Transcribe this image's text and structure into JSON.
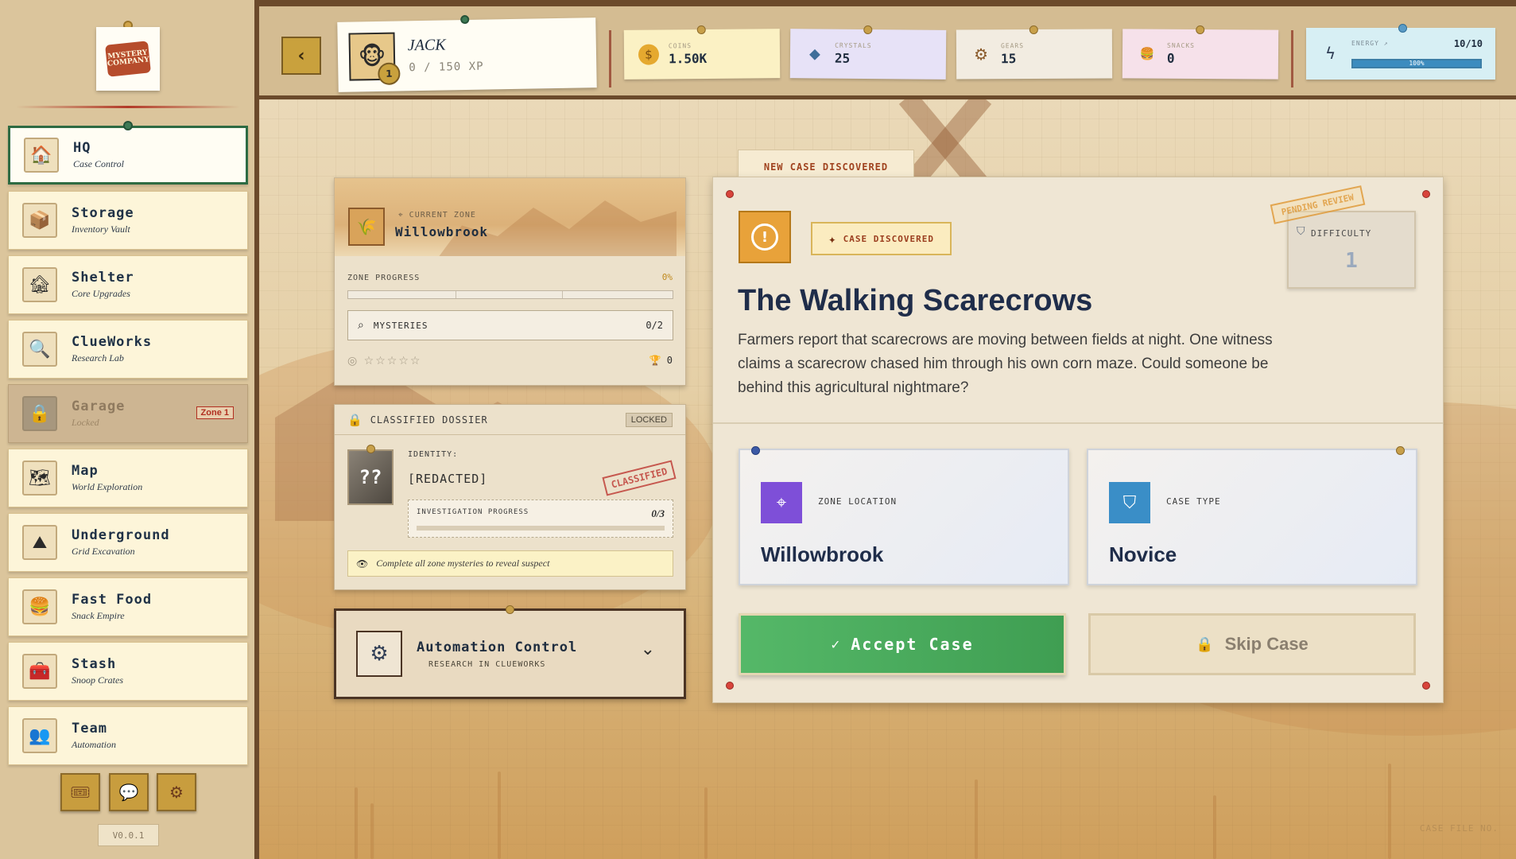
{
  "sidebar": {
    "logo_text": "MYSTERY COMPANY",
    "items": [
      {
        "title": "HQ",
        "subtitle": "Case Control",
        "icon": "🏠"
      },
      {
        "title": "Storage",
        "subtitle": "Inventory Vault",
        "icon": "📦"
      },
      {
        "title": "Shelter",
        "subtitle": "Core Upgrades",
        "icon": "🏚"
      },
      {
        "title": "ClueWorks",
        "subtitle": "Research Lab",
        "icon": "🔍"
      },
      {
        "title": "Garage",
        "subtitle": "Locked",
        "icon": "🔒",
        "tag": "Zone 1"
      },
      {
        "title": "Map",
        "subtitle": "World Exploration",
        "icon": "🗺"
      },
      {
        "title": "Underground",
        "subtitle": "Grid Excavation",
        "icon": "⛰"
      },
      {
        "title": "Fast Food",
        "subtitle": "Snack Empire",
        "icon": "🍔"
      },
      {
        "title": "Stash",
        "subtitle": "Snoop Crates",
        "icon": "🧰"
      },
      {
        "title": "Team",
        "subtitle": "Automation",
        "icon": "👥"
      }
    ],
    "version": "V0.0.1"
  },
  "player": {
    "name": "JACK",
    "xp": "0 / 150 XP",
    "level": "1"
  },
  "resources": [
    {
      "label": "COINS",
      "value": "1.50K",
      "icon": "$",
      "color": "#fbf1c4"
    },
    {
      "label": "CRYSTALS",
      "value": "25",
      "icon": "◆",
      "color": "#e7e2f7"
    },
    {
      "label": "GEARS",
      "value": "15",
      "icon": "⚙",
      "color": "#f2ece1"
    },
    {
      "label": "SNACKS",
      "value": "0",
      "icon": "🍔",
      "color": "#f6e1ea"
    }
  ],
  "energy": {
    "label": "ENERGY",
    "value": "10/10",
    "percent_label": "100%",
    "fill": 1.0
  },
  "zone": {
    "current_label": "CURRENT ZONE",
    "name": "Willowbrook",
    "progress_label": "ZONE PROGRESS",
    "progress_value": "0%",
    "mysteries_label": "MYSTERIES",
    "mysteries_value": "0/2",
    "stars": "☆☆☆☆☆",
    "trophies": "0"
  },
  "dossier": {
    "title": "CLASSIFIED DOSSIER",
    "badge": "LOCKED",
    "identity_label": "IDENTITY:",
    "identity_value": "[REDACTED]",
    "stamp": "CLASSIFIED",
    "portrait": "??",
    "progress_label": "INVESTIGATION PROGRESS",
    "progress_value": "0/3",
    "hint": "Complete all zone mysteries to reveal suspect"
  },
  "automation": {
    "title": "Automation Control",
    "subtitle": "RESEARCH IN CLUEWORKS"
  },
  "case": {
    "tab": "NEW CASE DISCOVERED",
    "badge": "CASE DISCOVERED",
    "pending": "PENDING REVIEW",
    "difficulty_label": "DIFFICULTY",
    "difficulty_value": "1",
    "title": "The Walking Scarecrows",
    "description": "Farmers report that scarecrows are moving between fields at night. One witness claims a scarecrow chased him through his own corn maze. Could someone be behind this agricultural nightmare?",
    "zone_label": "ZONE LOCATION",
    "zone_value": "Willowbrook",
    "type_label": "CASE TYPE",
    "type_value": "Novice",
    "accept": "Accept Case",
    "skip": "Skip Case"
  },
  "colors": {
    "accept": "#4caf5f",
    "accent_gold": "#c9a13d",
    "nav_active_border": "#2e6b43",
    "title_navy": "#1f2d4a"
  }
}
